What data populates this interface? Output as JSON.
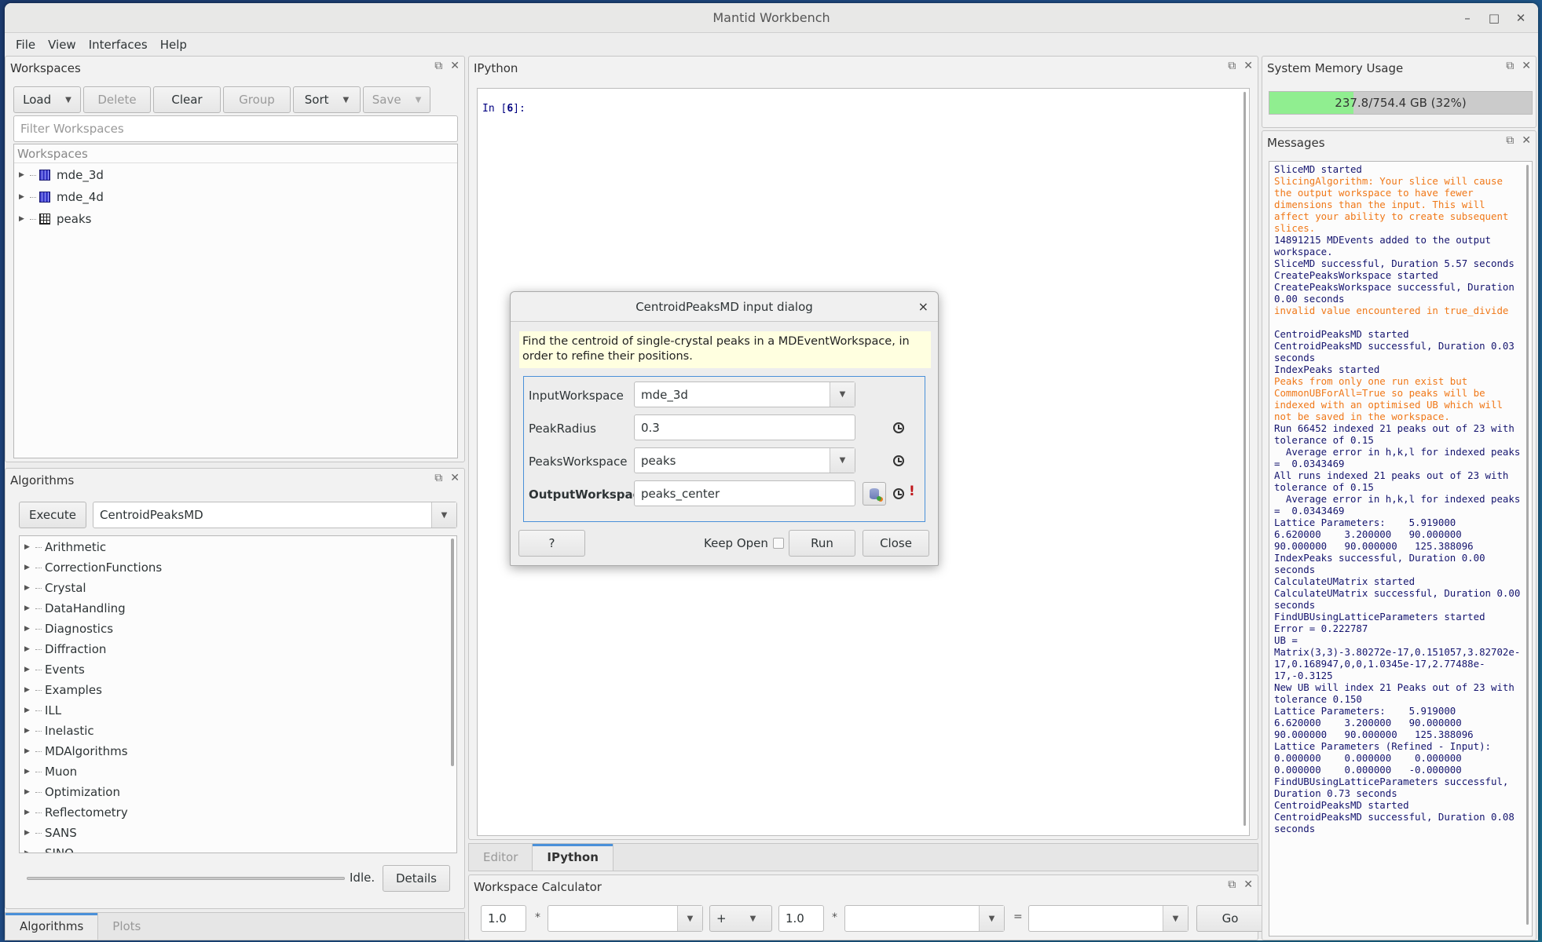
{
  "window": {
    "title": "Mantid Workbench",
    "controls": {
      "minimize": "–",
      "maximize": "□",
      "close": "✕"
    }
  },
  "menu": [
    "File",
    "View",
    "Interfaces",
    "Help"
  ],
  "workspaces_panel": {
    "title": "Workspaces",
    "buttons": {
      "load": "Load",
      "delete": "Delete",
      "clear": "Clear",
      "group": "Group",
      "sort": "Sort",
      "save": "Save"
    },
    "filter_placeholder": "Filter Workspaces",
    "tree_header": "Workspaces",
    "items": [
      {
        "name": "mde_3d",
        "icon": "md-workspace-icon"
      },
      {
        "name": "mde_4d",
        "icon": "md-workspace-icon"
      },
      {
        "name": "peaks",
        "icon": "table-workspace-icon"
      }
    ]
  },
  "algorithms_panel": {
    "title": "Algorithms",
    "execute_label": "Execute",
    "selected_algorithm": "CentroidPeaksMD",
    "categories": [
      "Arithmetic",
      "CorrectionFunctions",
      "Crystal",
      "DataHandling",
      "Diagnostics",
      "Diffraction",
      "Events",
      "Examples",
      "ILL",
      "Inelastic",
      "MDAlgorithms",
      "Muon",
      "Optimization",
      "Reflectometry",
      "SANS",
      "SINQ"
    ],
    "status": "Idle.",
    "details_label": "Details"
  },
  "left_tabs": [
    {
      "label": "Algorithms",
      "active": true
    },
    {
      "label": "Plots",
      "active": false
    }
  ],
  "ipython_panel": {
    "title": "IPython",
    "prompt_prefix": "In [",
    "prompt_number": "6",
    "prompt_suffix": "]:"
  },
  "center_tabs": [
    {
      "label": "Editor",
      "active": false
    },
    {
      "label": "IPython",
      "active": true
    }
  ],
  "workspace_calculator": {
    "title": "Workspace Calculator",
    "lhs_scale": "1.0",
    "lhs_workspace": "",
    "operator": "+",
    "rhs_scale": "1.0",
    "rhs_workspace": "",
    "output_workspace": "",
    "multiply_symbol": "*",
    "equals_symbol": "=",
    "go_label": "Go"
  },
  "memory_panel": {
    "title": "System Memory Usage",
    "text": "237.8/754.4 GB (32%)",
    "used_fraction": 0.32,
    "fill_color": "#90ee90"
  },
  "messages_panel": {
    "title": "Messages",
    "colors": {
      "notice": "#14146e",
      "warning": "#f07818"
    },
    "lines": [
      {
        "type": "notice",
        "text": "SliceMD started"
      },
      {
        "type": "warning",
        "text": "SlicingAlgorithm: Your slice will cause the output workspace to have fewer dimensions than the input. This will affect your ability to create subsequent slices."
      },
      {
        "type": "notice",
        "text": "14891215 MDEvents added to the output workspace."
      },
      {
        "type": "notice",
        "text": "SliceMD successful, Duration 5.57 seconds"
      },
      {
        "type": "notice",
        "text": "CreatePeaksWorkspace started"
      },
      {
        "type": "notice",
        "text": "CreatePeaksWorkspace successful, Duration 0.00 seconds"
      },
      {
        "type": "warning",
        "text": "invalid value encountered in true_divide"
      },
      {
        "type": "blank",
        "text": ""
      },
      {
        "type": "notice",
        "text": "CentroidPeaksMD started"
      },
      {
        "type": "notice",
        "text": "CentroidPeaksMD successful, Duration 0.03 seconds"
      },
      {
        "type": "notice",
        "text": "IndexPeaks started"
      },
      {
        "type": "warning",
        "text": "Peaks from only one run exist but CommonUBForAll=True so peaks will be indexed with an optimised UB which will not be saved in the workspace."
      },
      {
        "type": "notice",
        "text": "Run 66452 indexed 21 peaks out of 23 with tolerance of 0.15"
      },
      {
        "type": "notice",
        "text": "  Average error in h,k,l for indexed peaks =  0.0343469"
      },
      {
        "type": "notice",
        "text": "All runs indexed 21 peaks out of 23 with tolerance of 0.15"
      },
      {
        "type": "notice",
        "text": "  Average error in h,k,l for indexed peaks =  0.0343469"
      },
      {
        "type": "notice",
        "text": "Lattice Parameters:    5.919000\n6.620000    3.200000   90.000000\n90.000000   90.000000   125.388096"
      },
      {
        "type": "notice",
        "text": "IndexPeaks successful, Duration 0.00 seconds"
      },
      {
        "type": "notice",
        "text": "CalculateUMatrix started"
      },
      {
        "type": "notice",
        "text": "CalculateUMatrix successful, Duration 0.00 seconds"
      },
      {
        "type": "notice",
        "text": "FindUBUsingLatticeParameters started"
      },
      {
        "type": "notice",
        "text": "Error = 0.222787"
      },
      {
        "type": "notice",
        "text": "UB ="
      },
      {
        "type": "notice",
        "text": "Matrix(3,3)-3.80272e-17,0.151057,3.82702e-17,0.168947,0,0,1.0345e-17,2.77488e-17,-0.3125"
      },
      {
        "type": "notice",
        "text": "New UB will index 21 Peaks out of 23 with tolerance 0.150"
      },
      {
        "type": "notice",
        "text": "Lattice Parameters:    5.919000\n6.620000    3.200000   90.000000\n90.000000   90.000000   125.388096"
      },
      {
        "type": "notice",
        "text": "Lattice Parameters (Refined - Input):\n0.000000    0.000000    0.000000\n0.000000    0.000000   -0.000000"
      },
      {
        "type": "notice",
        "text": "FindUBUsingLatticeParameters successful, Duration 0.73 seconds"
      },
      {
        "type": "notice",
        "text": "CentroidPeaksMD started"
      },
      {
        "type": "notice",
        "text": "CentroidPeaksMD successful, Duration 0.08 seconds"
      }
    ]
  },
  "dialog": {
    "title": "CentroidPeaksMD input dialog",
    "close": "×",
    "description": "Find the centroid of single-crystal peaks in a MDEventWorkspace, in order to refine their positions.",
    "params": [
      {
        "label": "InputWorkspace",
        "value": "mde_3d",
        "kind": "combo",
        "history": false
      },
      {
        "label": "PeakRadius",
        "value": "0.3",
        "kind": "text",
        "history": true
      },
      {
        "label": "PeaksWorkspace",
        "value": "peaks",
        "kind": "combo",
        "history": true
      },
      {
        "label": "OutputWorkspace",
        "value": "peaks_center",
        "kind": "text",
        "history": true,
        "required": true,
        "invalid_marker": "!"
      }
    ],
    "help_label": "?",
    "keep_open_label": "Keep Open",
    "keep_open_checked": false,
    "run_label": "Run",
    "close_label": "Close"
  }
}
